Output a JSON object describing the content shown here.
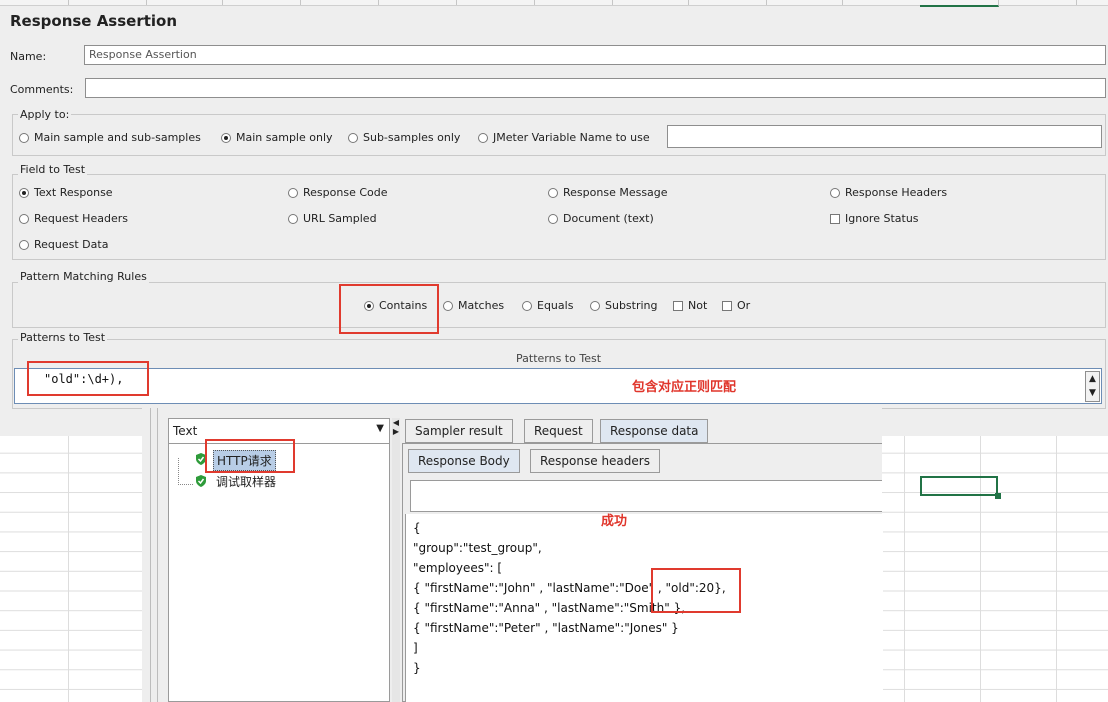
{
  "window_title": "Response Assertion",
  "name_field": {
    "label": "Name:",
    "value": "Response Assertion"
  },
  "comments_field": {
    "label": "Comments:",
    "value": ""
  },
  "apply_to": {
    "legend": "Apply to:",
    "options": [
      "Main sample and sub-samples",
      "Main sample only",
      "Sub-samples only",
      "JMeter Variable Name to use"
    ],
    "selected": "Main sample only",
    "variable_value": ""
  },
  "field_to_test": {
    "legend": "Field to Test",
    "options": [
      "Text Response",
      "Response Code",
      "Response Message",
      "Response Headers",
      "Request Headers",
      "URL Sampled",
      "Document (text)",
      "Request Data"
    ],
    "ignore_status_label": "Ignore Status",
    "selected": "Text Response"
  },
  "pattern_rules": {
    "legend": "Pattern Matching Rules",
    "options": [
      "Contains",
      "Matches",
      "Equals",
      "Substring"
    ],
    "checkboxes": [
      "Not",
      "Or"
    ],
    "selected": "Contains"
  },
  "patterns": {
    "legend": "Patterns to Test",
    "header": "Patterns to Test",
    "value": "\"old\":\\d+),",
    "annotation": "包含对应正则匹配"
  },
  "results_tree": {
    "renderer": "Text",
    "nodes": [
      "HTTP请求",
      "调试取样器"
    ],
    "tabs": [
      "Sampler result",
      "Request",
      "Response data"
    ],
    "subtabs": [
      "Response Body",
      "Response headers"
    ],
    "annotation": "成功",
    "body_lines": [
      "{",
      "\"group\":\"test_group\",",
      "\"employees\": [",
      "{ \"firstName\":\"John\" , \"lastName\":\"Doe\" , \"old\":20},",
      "{ \"firstName\":\"Anna\" , \"lastName\":\"Smith\" },",
      "{ \"firstName\":\"Peter\" , \"lastName\":\"Jones\" }",
      "]",
      "}"
    ]
  },
  "colors": {
    "annotation_red": "#e0352b",
    "excel_green": "#217346",
    "selection_blue": "#b8cde6"
  }
}
